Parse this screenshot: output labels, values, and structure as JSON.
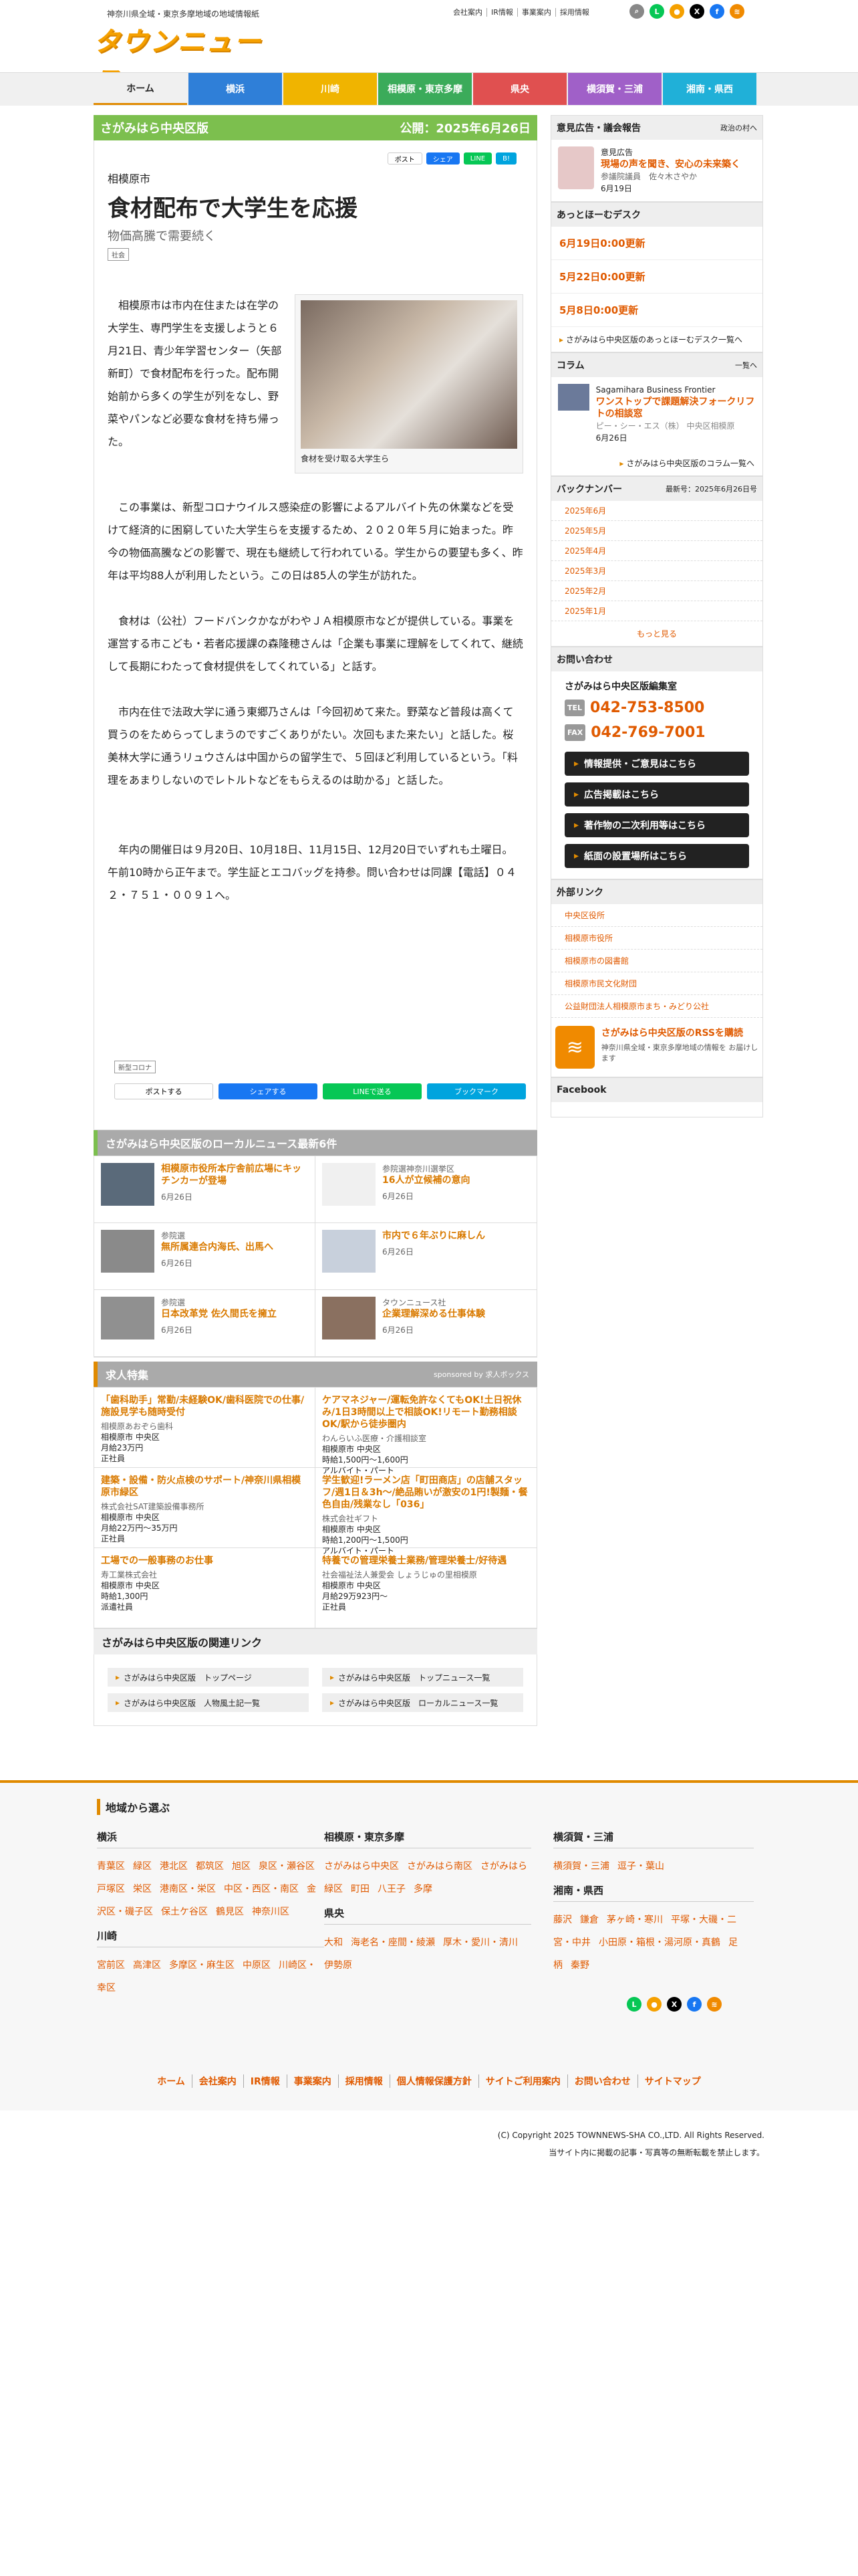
{
  "header": {
    "tagline": "神奈川県全域・東京多摩地域の地域情報紙",
    "logo": "タウンニュース",
    "links": [
      "会社案内",
      "IR情報",
      "事業案内",
      "採用情報"
    ]
  },
  "nav": [
    {
      "label": "ホーム",
      "color": "#f0f0f0"
    },
    {
      "label": "横浜",
      "color": "#2f7fd8"
    },
    {
      "label": "川崎",
      "color": "#f0b400"
    },
    {
      "label": "相模原・東京多摩",
      "color": "#3bab5a"
    },
    {
      "label": "県央",
      "color": "#e05050"
    },
    {
      "label": "横須賀・三浦",
      "color": "#a060c8"
    },
    {
      "label": "湘南・県西",
      "color": "#20b0d8"
    }
  ],
  "article": {
    "edition": "さがみはら中央区版",
    "published": "公開：2025年6月26日",
    "share_top": [
      "ポスト",
      "シェア",
      "LINE",
      "B!"
    ],
    "kicker": "相模原市",
    "title": "食材配布で大学生を応援",
    "subtitle": "物価高騰で需要続く",
    "tag": "社会",
    "photo_caption": "食材を受け取る大学生ら",
    "intro": "相模原市は市内在住または在学の大学生、専門学生を支援しようと６月21日、青少年学習センター（矢部新町）で食材配布を行った。配布開始前から多くの学生が列をなし、野菜やパンなど必要な食材を持ち帰った。",
    "paras": [
      "この事業は、新型コロナウイルス感染症の影響によるアルバイト先の休業などを受けて経済的に困窮していた大学生らを支援するため、２０２０年５月に始まった。昨今の物価高騰などの影響で、現在も継続して行われている。学生からの要望も多く、昨年は平均88人が利用したという。この日は85人の学生が訪れた。",
      "食材は（公社）フードバンクかながわやＪＡ相模原市などが提供している。事業を運営する市こども・若者応援課の森隆穂さんは「企業も事業に理解をしてくれて、継続して長期にわたって食材提供をしてくれている」と話す。",
      "市内在住で法政大学に通う東郷乃さんは「今回初めて来た。野菜など普段は高くて買うのをためらってしまうのですごくありがたい。次回もまた来たい」と話した。桜美林大学に通うリュウさんは中国からの留学生で、５回ほど利用しているという。「料理をあまりしないのでレトルトなどをもらえるのは助かる」と話した。",
      "年内の開催日は９月20日、10月18日、11月15日、12月20日でいずれも土曜日。午前10時から正午まで。学生証とエコバッグを持参。問い合わせは同課【電話】０４２・７５１・００９１へ。"
    ],
    "bottom_tag": "新型コロナ",
    "share_bottom": [
      "ポストする",
      "シェアする",
      "LINEで送る",
      "ブックマーク"
    ]
  },
  "local_news": {
    "heading": "さがみはら中央区版のローカルニュース最新6件",
    "items": [
      {
        "src": "",
        "title": "相模原市役所本庁舎前広場にキッチンカーが登場",
        "date": "6月26日"
      },
      {
        "src": "参院選神奈川選挙区",
        "title": "16人が立候補の意向",
        "date": "6月26日"
      },
      {
        "src": "参院選",
        "title": "無所属連合内海氏、出馬へ",
        "date": "6月26日"
      },
      {
        "src": "",
        "title": "市内で６年ぶりに麻しん",
        "date": "6月26日"
      },
      {
        "src": "参院選",
        "title": "日本改革党 佐久間氏を擁立",
        "date": "6月26日"
      },
      {
        "src": "タウンニュース社",
        "title": "企業理解深める仕事体験",
        "date": "6月26日"
      }
    ]
  },
  "jobs": {
    "heading": "求人特集",
    "sponsor": "sponsored by 求人ボックス",
    "items": [
      {
        "title": "「歯科助手」常勤/未経験OK/歯科医院での仕事/施設見学も随時受付",
        "co": "相模原あおぞら歯科",
        "loc": "相模原市 中央区",
        "pay": "月給23万円",
        "type": "正社員"
      },
      {
        "title": "ケアマネジャー/運転免許なくてもOK!土日祝休み/1日3時間以上で相談OK!リモート勤務相談OK/駅から徒歩圏内",
        "co": "わんらいふ医療・介護相談室",
        "loc": "相模原市 中央区",
        "pay": "時給1,500円〜1,600円",
        "type": "アルバイト・パート"
      },
      {
        "title": "建築・設備・防火点検のサポート/神奈川県相模原市緑区",
        "co": "株式会社SAT建築設備事務所",
        "loc": "相模原市 中央区",
        "pay": "月給22万円〜35万円",
        "type": "正社員"
      },
      {
        "title": "学生歓迎!ラーメン店「町田商店」の店舗スタッフ/週1日＆3h〜/絶品賄いが激安の1円!製麺・餐色自由/残業なし「036」",
        "co": "株式会社ギフト",
        "loc": "相模原市 中央区",
        "pay": "時給1,200円〜1,500円",
        "type": "アルバイト・パート"
      },
      {
        "title": "工場での一般事務のお仕事",
        "co": "寿工業株式会社",
        "loc": "相模原市 中央区",
        "pay": "時給1,300円",
        "type": "派遣社員"
      },
      {
        "title": "特養での管理栄養士業務/管理栄養士/好待遇",
        "co": "社会福祉法人兼愛会 しょうじゅの里相模原",
        "loc": "相模原市 中央区",
        "pay": "月給29万923円〜",
        "type": "正社員"
      }
    ]
  },
  "related": {
    "heading": "さがみはら中央区版の関連リンク",
    "links": [
      "さがみはら中央区版　トップページ",
      "さがみはら中央区版　トップニュース一覧",
      "さがみはら中央区版　人物風土記一覧",
      "さがみはら中央区版　ローカルニュース一覧"
    ]
  },
  "side": {
    "opinion": {
      "heading": "意見広告・議会報告",
      "badge": "政治の村へ",
      "cat": "意見広告",
      "title": "現場の声を聞き、安心の未来築く",
      "who": "参議院議員　佐々木さやか",
      "date": "6月19日"
    },
    "desk": {
      "heading": "あっとほーむデスク",
      "items": [
        "6月19日0:00更新",
        "5月22日0:00更新",
        "5月8日0:00更新"
      ],
      "more": "さがみはら中央区版のあっとほーむデスク一覧へ"
    },
    "column": {
      "heading": "コラム",
      "link": "一覧へ",
      "src": "Sagamihara Business Frontier",
      "title": "ワンストップで課題解決フォークリフトの相談窓",
      "sub": "ピー・シー・エス（株） 中央区相模原",
      "date": "6月26日",
      "more": "さがみはら中央区版のコラム一覧へ"
    },
    "back": {
      "heading": "バックナンバー",
      "updated": "最新号：2025年6月26日号",
      "items": [
        "2025年6月",
        "2025年5月",
        "2025年4月",
        "2025年3月",
        "2025年2月",
        "2025年1月"
      ],
      "more": "もっと見る"
    },
    "contact": {
      "heading": "お問い合わせ",
      "name": "さがみはら中央区版編集室",
      "tel_label": "TEL",
      "tel": "042-753-8500",
      "fax_label": "FAX",
      "fax": "042-769-7001",
      "buttons": [
        "情報提供・ご意見はこちら",
        "広告掲載はこちら",
        "著作物の二次利用等はこちら",
        "紙面の設置場所はこちら"
      ]
    },
    "ext": {
      "heading": "外部リンク",
      "items": [
        "中央区役所",
        "相模原市役所",
        "相模原市の図書館",
        "相模原市民文化財団",
        "公益財団法人相模原市まち・みどり公社"
      ]
    },
    "rss": {
      "title": "さがみはら中央区版のRSSを購読",
      "sub": "神奈川県全域・東京多摩地域の情報を お届けします"
    },
    "facebook": "Facebook"
  },
  "footer": {
    "heading": "地域から選ぶ",
    "cols": [
      {
        "title": "横浜",
        "links": [
          "青葉区",
          "緑区",
          "港北区",
          "都筑区",
          "旭区",
          "泉区・瀬谷区",
          "戸塚区",
          "栄区",
          "港南区・栄区",
          "中区・西区・南区",
          "金沢区・磯子区",
          "保土ケ谷区",
          "鶴見区",
          "神奈川区"
        ]
      },
      {
        "title": "川崎",
        "links": [
          "宮前区",
          "高津区",
          "多摩区・麻生区",
          "中原区",
          "川崎区・幸区"
        ]
      },
      {
        "title": "相模原・東京多摩",
        "links": [
          "さがみはら中央区",
          "さがみはら南区",
          "さがみはら緑区",
          "町田",
          "八王子",
          "多摩"
        ]
      },
      {
        "title": "県央",
        "links": [
          "大和",
          "海老名・座間・綾瀬",
          "厚木・愛川・清川",
          "伊勢原"
        ]
      },
      {
        "title": "横須賀・三浦",
        "links": [
          "横須賀・三浦",
          "逗子・葉山"
        ]
      },
      {
        "title": "湘南・県西",
        "links": [
          "藤沢",
          "鎌倉",
          "茅ヶ崎・寒川",
          "平塚・大磯・二宮・中井",
          "小田原・箱根・湯河原・真鶴",
          "足柄",
          "秦野"
        ]
      }
    ],
    "nav": [
      "ホーム",
      "会社案内",
      "IR情報",
      "事業案内",
      "採用情報",
      "個人情報保護方針",
      "サイトご利用案内",
      "お問い合わせ",
      "サイトマップ"
    ],
    "copyright": "(C) Copyright 2025 TOWNNEWS-SHA CO.,LTD. All Rights Reserved.",
    "notice": "当サイト内に掲載の記事・写真等の無断転載を禁止します。"
  }
}
